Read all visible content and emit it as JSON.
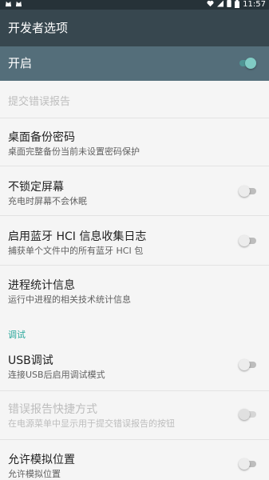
{
  "status_bar": {
    "time": "11:57",
    "icons": [
      "cat-icon",
      "cat-icon",
      "heart-icon",
      "signal-icon",
      "sim-icon",
      "battery-icon"
    ]
  },
  "app_bar": {
    "title": "开发者选项"
  },
  "master_switch": {
    "label": "开启",
    "on": true
  },
  "items": [
    {
      "title": "提交错误报告",
      "subtitle": "",
      "enabled": false
    },
    {
      "title": "桌面备份密码",
      "subtitle": "桌面完整备份当前未设置密码保护",
      "enabled": true
    },
    {
      "title": "不锁定屏幕",
      "subtitle": "充电时屏幕不会休眠",
      "enabled": true,
      "switch_on": false
    },
    {
      "title": "启用蓝牙 HCI 信息收集日志",
      "subtitle": "捕获单个文件中的所有蓝牙 HCI 包",
      "enabled": true,
      "switch_on": false
    },
    {
      "title": "进程统计信息",
      "subtitle": "运行中进程的相关技术统计信息",
      "enabled": true
    }
  ],
  "debug_section": {
    "header": "调试",
    "items": [
      {
        "title": "USB调试",
        "subtitle": "连接USB后启用调试模式",
        "enabled": true,
        "switch_on": false
      },
      {
        "title": "错误报告快捷方式",
        "subtitle": "在电源菜单中显示用于提交错误报告的按钮",
        "enabled": false,
        "switch_on": false
      },
      {
        "title": "允许模拟位置",
        "subtitle": "允许模拟位置",
        "enabled": true,
        "switch_on": false
      }
    ]
  },
  "colors": {
    "status_bar": "#263238",
    "app_bar": "#37474f",
    "master_bar": "#546e7a",
    "accent": "#26a69a"
  }
}
